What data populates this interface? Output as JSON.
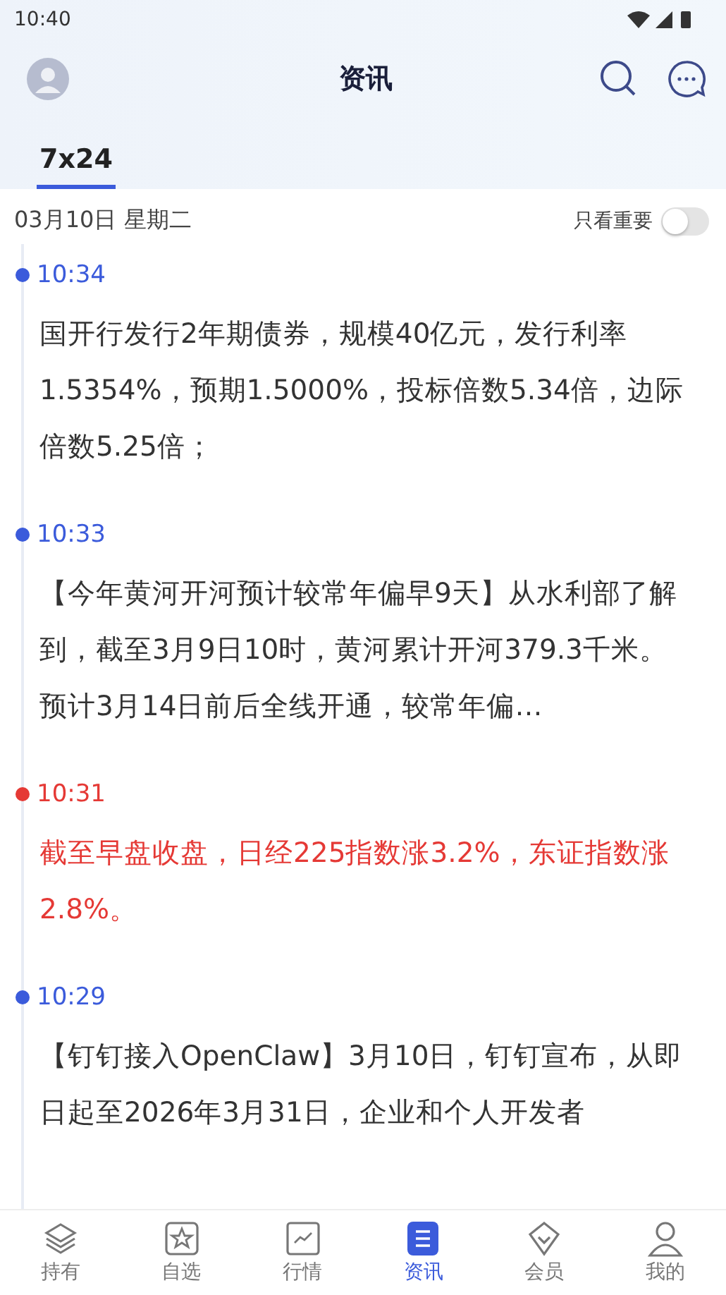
{
  "status_bar": {
    "time": "10:40"
  },
  "header": {
    "title": "资讯"
  },
  "tabs": [
    {
      "label": "7x24",
      "selected": true
    }
  ],
  "date_row": {
    "date": "03月10日 星期二",
    "filter_label": "只看重要",
    "filter_on": false
  },
  "news": [
    {
      "time": "10:34",
      "important": false,
      "text": "国开行发行2年期债券，规模40亿元，发行利率1.5354%，预期1.5000%，投标倍数5.34倍，边际倍数5.25倍；"
    },
    {
      "time": "10:33",
      "important": false,
      "text": "【今年黄河开河预计较常年偏早9天】从水利部了解到，截至3月9日10时，黄河累计开河379.3千米。预计3月14日前后全线开通，较常年偏…"
    },
    {
      "time": "10:31",
      "important": true,
      "text": "截至早盘收盘，日经225指数涨3.2%，东证指数涨2.8%。"
    },
    {
      "time": "10:29",
      "important": false,
      "text": "【钉钉接入OpenClaw】3月10日，钉钉宣布，从即日起至2026年3月31日，企业和个人开发者"
    }
  ],
  "bottom_nav": [
    {
      "kind": "layers",
      "label": "持有",
      "selected": false
    },
    {
      "kind": "star",
      "label": "自选",
      "selected": false
    },
    {
      "kind": "chart",
      "label": "行情",
      "selected": false
    },
    {
      "kind": "doc",
      "label": "资讯",
      "selected": true
    },
    {
      "kind": "diamond",
      "label": "会员",
      "selected": false
    },
    {
      "kind": "person",
      "label": "我的",
      "selected": false
    }
  ]
}
